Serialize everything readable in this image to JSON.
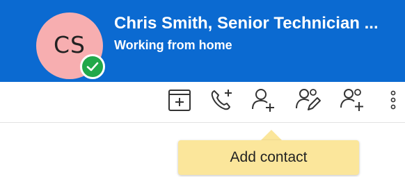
{
  "contact": {
    "initials": "CS",
    "name": "Chris Smith, Senior Technician ...",
    "status": "Working from home",
    "presence": "available",
    "avatar_color": "#f7aeb0",
    "presence_color": "#21a84a"
  },
  "header": {
    "background_color": "#0b6ad1"
  },
  "toolbar": {
    "buttons": [
      {
        "icon": "calendar-add-icon"
      },
      {
        "icon": "phone-add-icon"
      },
      {
        "icon": "add-person-icon"
      },
      {
        "icon": "edit-contact-icon"
      },
      {
        "icon": "add-to-group-icon"
      },
      {
        "icon": "more-options-icon"
      }
    ]
  },
  "tooltip": {
    "text": "Add contact",
    "background_color": "#fbe69b"
  }
}
